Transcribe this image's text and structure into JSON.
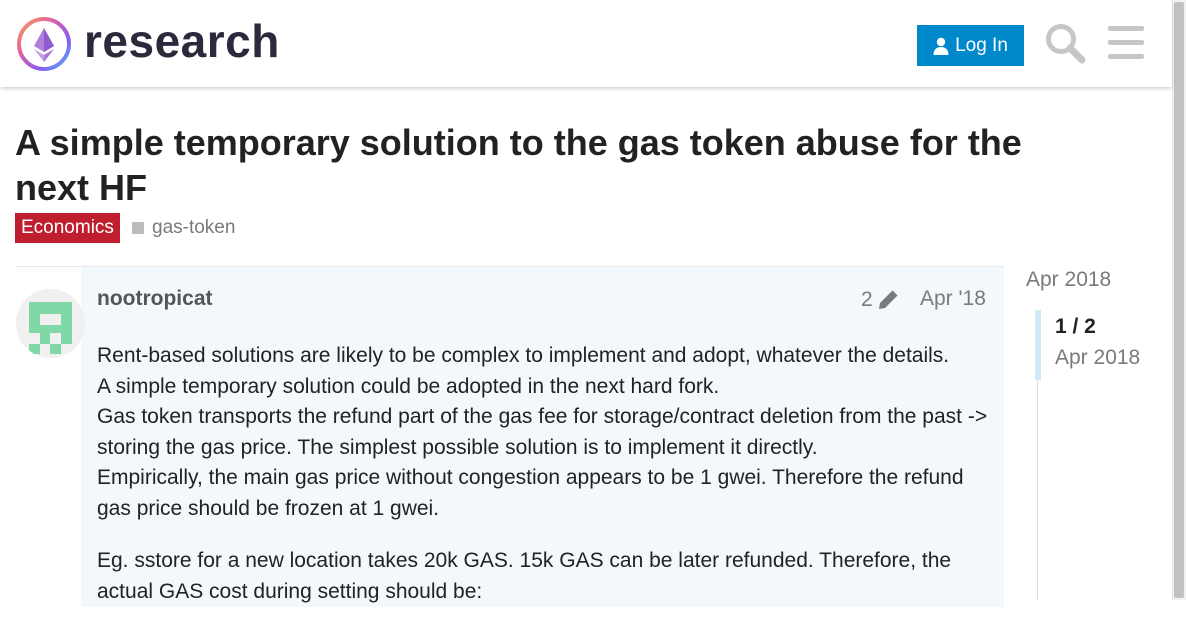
{
  "header": {
    "brand": "research",
    "login_label": "Log In",
    "icons": [
      "ethereum-logo-icon",
      "user-icon",
      "search-icon",
      "hamburger-menu-icon"
    ]
  },
  "topic": {
    "title": "A simple temporary solution to the gas token abuse for the next HF",
    "category": "Economics",
    "category_color": "#be1e2d",
    "tag": "gas-token"
  },
  "post": {
    "username": "nootropicat",
    "edit_count": "2",
    "date": "Apr '18",
    "paragraphs": [
      "Rent-based solutions are likely to be complex to implement and adopt, whatever the details.\nA simple temporary solution could be adopted in the next hard fork.\nGas token transports the refund part of the gas fee for storage/contract deletion from the past -> storing the gas price. The simplest possible solution is to implement it directly.\nEmpirically, the main gas price without congestion appears to be 1 gwei. Therefore the refund gas price should be frozen at 1 gwei.",
      "Eg. sstore for a new location takes 20k GAS. 15k GAS can be later refunded. Therefore, the actual GAS cost during setting should be:"
    ]
  },
  "timeline": {
    "top_date": "Apr 2018",
    "position": "1 / 2",
    "current_date": "Apr 2018"
  },
  "colors": {
    "accent": "#0088cc",
    "post_bg": "#f2f8fc"
  }
}
